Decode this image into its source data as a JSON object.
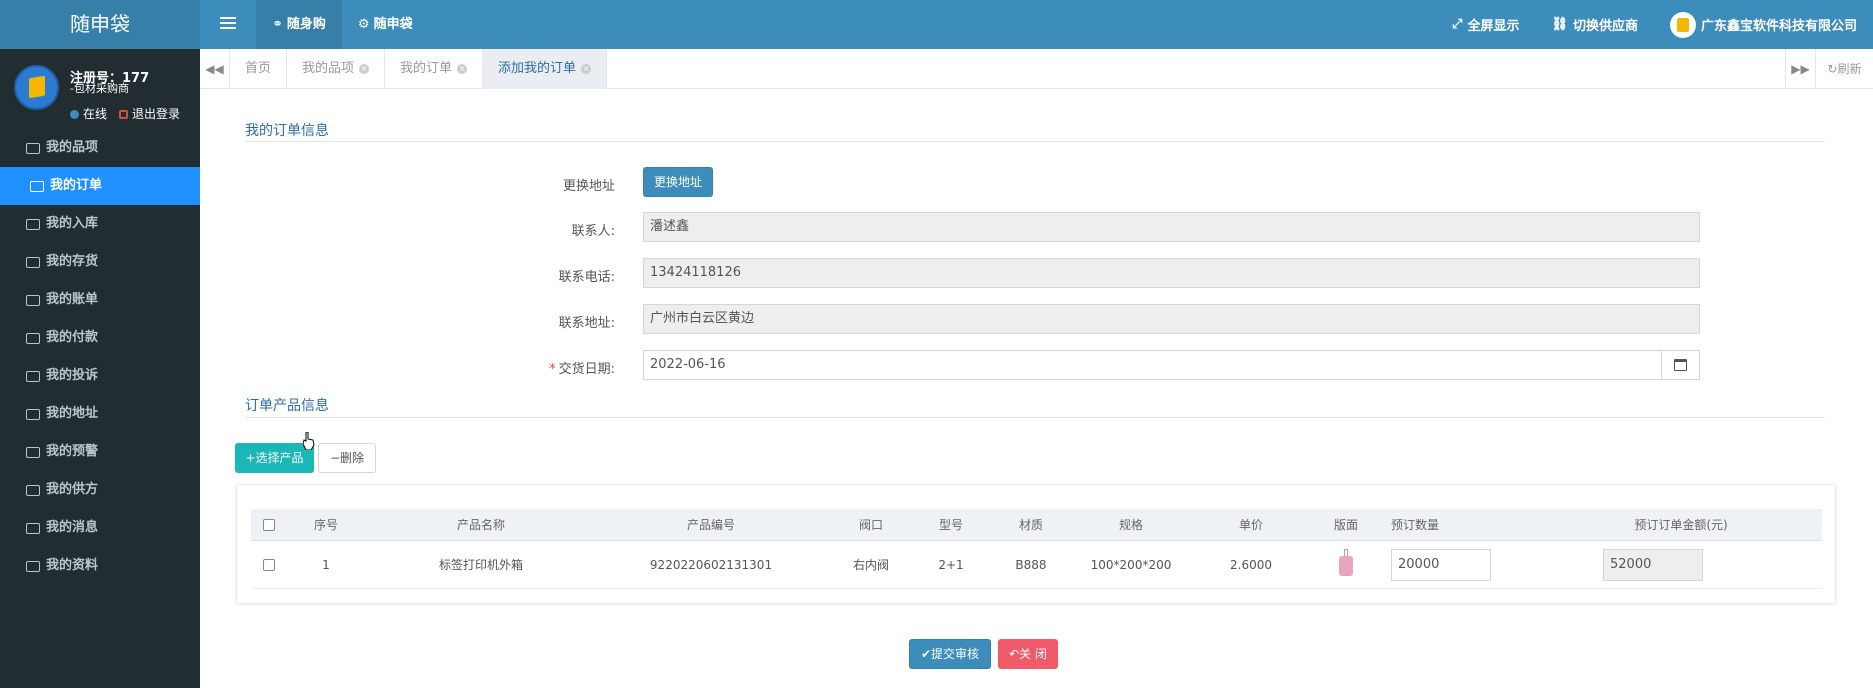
{
  "header": {
    "brand": "随申袋",
    "nav": [
      {
        "label": "随身购",
        "icon": "handshake-icon",
        "active": true
      },
      {
        "label": "随申袋",
        "icon": "gear-icon",
        "active": false
      }
    ],
    "fullscreen": "全屏显示",
    "switch_supplier": "切换供应商",
    "company": "广东鑫宝软件科技有限公司"
  },
  "user": {
    "reg_no": "注册号：177",
    "role": "-包材采购商",
    "online": "在线",
    "logout": "退出登录"
  },
  "sidebar": {
    "items": [
      {
        "label": "我的品项",
        "icon": "sitemap-icon"
      },
      {
        "label": "我的订单",
        "icon": "desktop-icon",
        "active": true
      },
      {
        "label": "我的入库",
        "icon": "bus-icon"
      },
      {
        "label": "我的存货",
        "icon": "cubes-icon"
      },
      {
        "label": "我的账单",
        "icon": "keyboard-icon"
      },
      {
        "label": "我的付款",
        "icon": "credit-card-icon"
      },
      {
        "label": "我的投诉",
        "icon": "headphones-icon"
      },
      {
        "label": "我的地址",
        "icon": "paper-plane-icon"
      },
      {
        "label": "我的预警",
        "icon": "bell-slash-icon"
      },
      {
        "label": "我的供方",
        "icon": "hourglass-icon"
      },
      {
        "label": "我的消息",
        "icon": "globe-icon"
      },
      {
        "label": "我的资料",
        "icon": "id-card-icon"
      }
    ]
  },
  "tabs": [
    {
      "label": "首页",
      "closable": false
    },
    {
      "label": "我的品项",
      "closable": true
    },
    {
      "label": "我的订单",
      "closable": true
    },
    {
      "label": "添加我的订单",
      "closable": true,
      "active": true
    }
  ],
  "refresh": "刷新",
  "order_info": {
    "title": "我的订单信息",
    "change_address_label": "更换地址",
    "change_address_btn": "更换地址",
    "contact_label": "联系人:",
    "contact_value": "潘述鑫",
    "phone_label": "联系电话:",
    "phone_value": "13424118126",
    "address_label": "联系地址:",
    "address_value": "广州市白云区黄边",
    "date_label": "交货日期:",
    "date_value": "2022-06-16"
  },
  "product_info": {
    "title": "订单产品信息",
    "select_btn": "+选择产品",
    "delete_btn": "删除",
    "columns": [
      "序号",
      "产品名称",
      "产品编号",
      "阀口",
      "型号",
      "材质",
      "规格",
      "单价",
      "版面",
      "预订数量",
      "预订订单金额(元)"
    ],
    "rows": [
      {
        "seq": "1",
        "name": "标签打印机外箱",
        "code": "9220220602131301",
        "valve": "右内阀",
        "model": "2+1",
        "material": "B888",
        "spec": "100*200*200",
        "price": "2.6000",
        "qty": "20000",
        "amount": "52000"
      }
    ]
  },
  "actions": {
    "submit": "提交审核",
    "close": "关 闭"
  },
  "colors": {
    "header": "#3c8dbc",
    "sidebar": "#222d32",
    "active_menu": "#1e90ff",
    "submit": "#3c8dbc",
    "close": "#f05b6b",
    "select_product": "#1bb6b6"
  }
}
